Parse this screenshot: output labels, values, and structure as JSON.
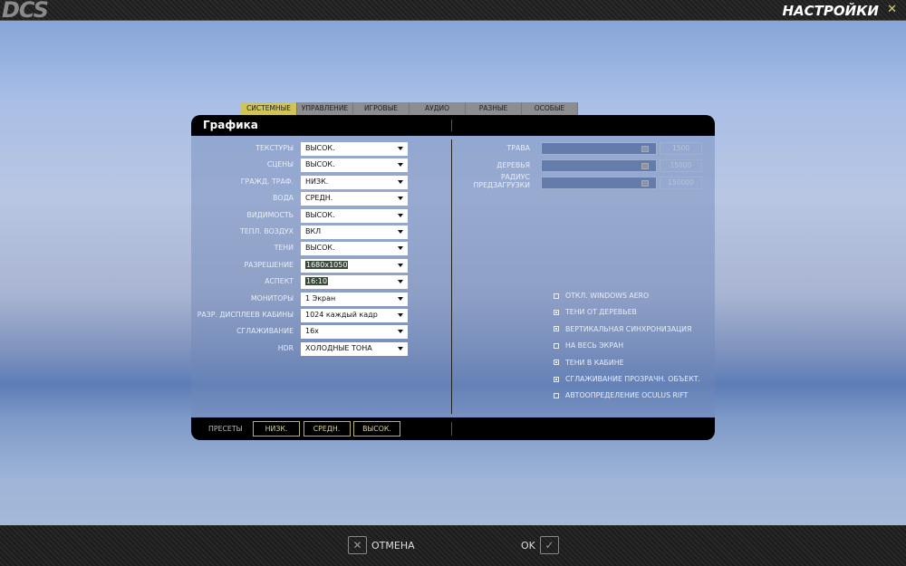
{
  "app": {
    "logo": "DCS",
    "title": "НАСТРОЙКИ"
  },
  "tabs": [
    {
      "label": "СИСТЕМНЫЕ",
      "active": true
    },
    {
      "label": "УПРАВЛЕНИЕ"
    },
    {
      "label": "ИГРОВЫЕ"
    },
    {
      "label": "АУДИО"
    },
    {
      "label": "РАЗНЫЕ"
    },
    {
      "label": "ОСОБЫЕ"
    }
  ],
  "panel": {
    "title": "Графика"
  },
  "settings": [
    {
      "label": "ТЕКСТУРЫ",
      "value": "ВЫСОК."
    },
    {
      "label": "СЦЕНЫ",
      "value": "ВЫСОК."
    },
    {
      "label": "ГРАЖД. ТРАФ.",
      "value": "НИЗК."
    },
    {
      "label": "ВОДА",
      "value": "СРЕДН."
    },
    {
      "label": "ВИДИМОСТЬ",
      "value": "ВЫСОК."
    },
    {
      "label": "ТЕПЛ. ВОЗДУХ",
      "value": "ВКЛ"
    },
    {
      "label": "ТЕНИ",
      "value": "ВЫСОК."
    },
    {
      "label": "РАЗРЕШЕНИЕ",
      "value": "1680x1050",
      "selected": true
    },
    {
      "label": "АСПЕКТ",
      "value": "16:10",
      "selected": true
    },
    {
      "label": "МОНИТОРЫ",
      "value": "1 Экран"
    },
    {
      "label": "РАЗР. ДИСПЛЕЕВ КАБИНЫ",
      "value": "1024 каждый кадр"
    },
    {
      "label": "СГЛАЖИВАНИЕ",
      "value": "16x"
    },
    {
      "label": "HDR",
      "value": "ХОЛОДНЫЕ ТОНА"
    }
  ],
  "sliders": [
    {
      "label": "ТРАВА",
      "value": "1500",
      "fraction": 0.95
    },
    {
      "label": "ДЕРЕВЬЯ",
      "value": "15000",
      "fraction": 0.95
    },
    {
      "label": "РАДИУС ПРЕДЗАГРУЗКИ",
      "value": "150000",
      "fraction": 0.95
    }
  ],
  "checkboxes": [
    {
      "label": "ОТКЛ. WINDOWS AERO",
      "checked": false
    },
    {
      "label": "ТЕНИ ОТ ДЕРЕВЬЕВ",
      "checked": true
    },
    {
      "label": "ВЕРТИКАЛЬНАЯ СИНХРОНИЗАЦИЯ",
      "checked": true
    },
    {
      "label": "НА ВЕСЬ ЭКРАН",
      "checked": false
    },
    {
      "label": "ТЕНИ В КАБИНЕ",
      "checked": true
    },
    {
      "label": "СГЛАЖИВАНИЕ ПРОЗРАЧН. ОБЪЕКТ.",
      "checked": true
    },
    {
      "label": "АВТООПРЕДЕЛЕНИЕ OCULUS RIFT",
      "checked": false
    }
  ],
  "presets": {
    "label": "ПРЕСЕТЫ",
    "buttons": [
      "НИЗК.",
      "СРЕДН.",
      "ВЫСОК."
    ]
  },
  "footer": {
    "cancel": "ОТМЕНА",
    "ok": "OK"
  }
}
